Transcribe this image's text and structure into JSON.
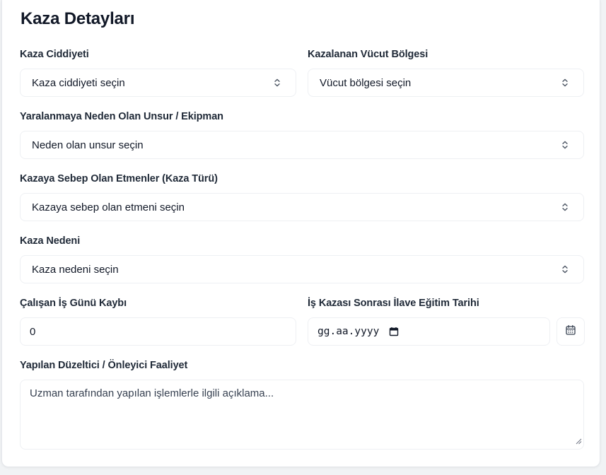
{
  "section": {
    "title": "Kaza Detayları"
  },
  "fields": {
    "severity": {
      "label": "Kaza Ciddiyeti",
      "value": "Kaza ciddiyeti seçin"
    },
    "body_part": {
      "label": "Kazalanan Vücut Bölgesi",
      "value": "Vücut bölgesi seçin"
    },
    "cause_item": {
      "label": "Yaralanmaya Neden Olan Unsur / Ekipman",
      "value": "Neden olan unsur seçin"
    },
    "accident_type": {
      "label": "Kazaya Sebep Olan Etmenler (Kaza Türü)",
      "value": "Kazaya sebep olan etmeni seçin"
    },
    "accident_reason": {
      "label": "Kaza Nedeni",
      "value": "Kaza nedeni seçin"
    },
    "lost_days": {
      "label": "Çalışan İş Günü Kaybı",
      "value": "0"
    },
    "training_date": {
      "label": "İş Kazası Sonrası İlave Eğitim Tarihi",
      "placeholder": "gg.aa.yyyy"
    },
    "corrective_action": {
      "label": "Yapılan Düzeltici / Önleyici Faaliyet",
      "placeholder": "Uzman tarafından yapılan işlemlerle ilgili açıklama..."
    }
  },
  "icons": {
    "select": "chevron-up-down-icon",
    "date": "calendar-icon",
    "resize": "resize-handle-icon"
  },
  "colors": {
    "card_bg": "#ffffff",
    "page_bg": "#f1f3f5",
    "border": "#eef0f3",
    "text": "#111827",
    "icon": "#6b7280"
  }
}
